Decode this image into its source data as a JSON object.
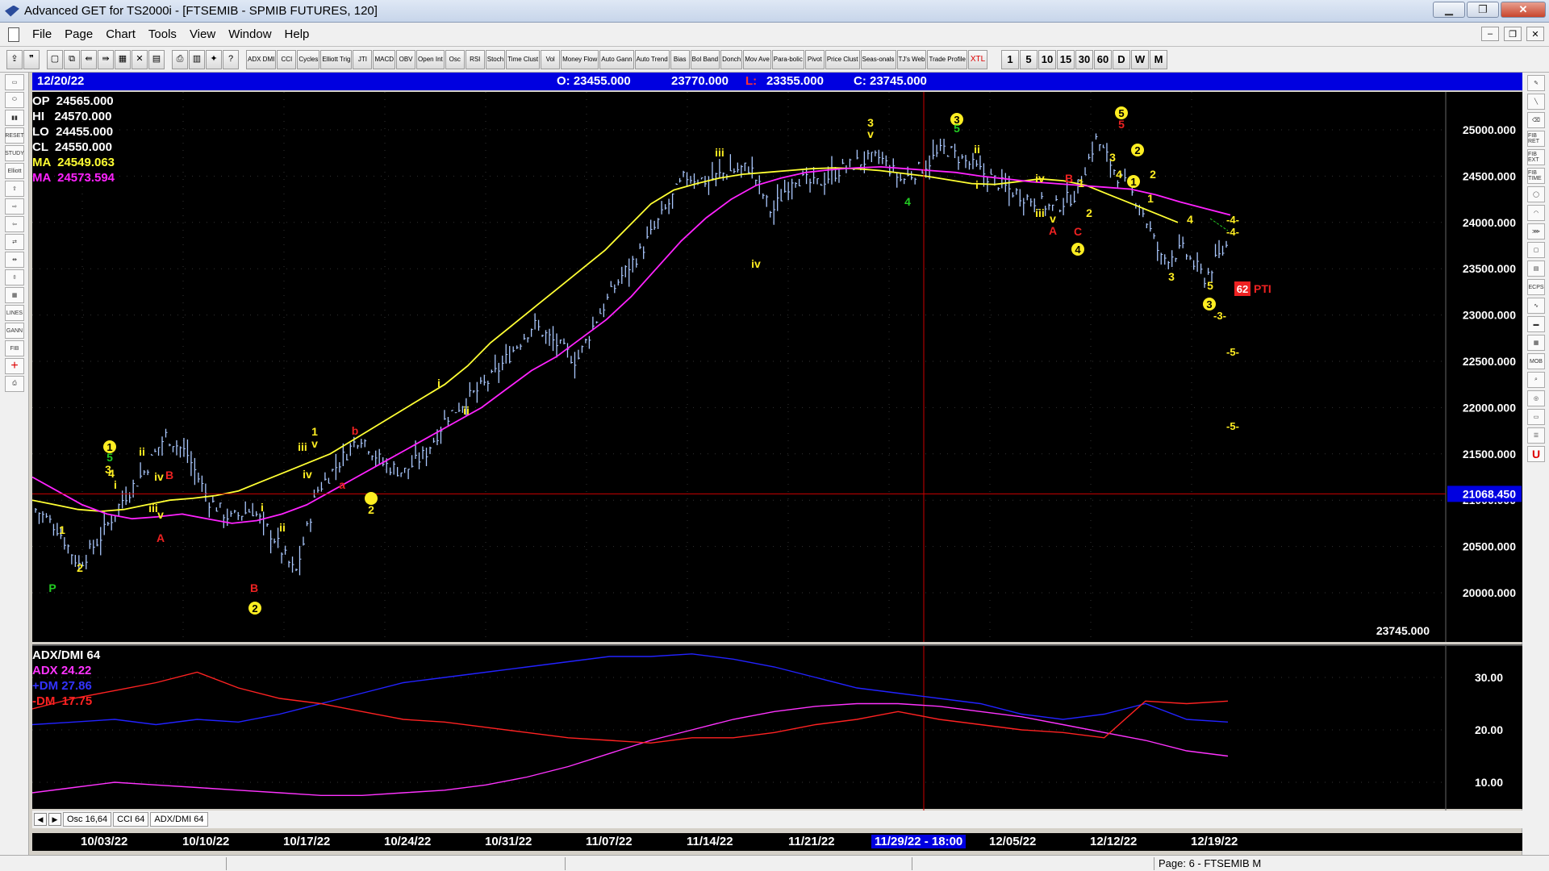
{
  "window": {
    "title": "Advanced GET for TS2000i - [FTSEMIB - SPMIB FUTURES, 120]",
    "ghost_title": "Advanced GET for TS2000i - [FTSEMIB - SPMIB FUTURES, 120]"
  },
  "menu": [
    "File",
    "Page",
    "Chart",
    "Tools",
    "View",
    "Window",
    "Help"
  ],
  "toolbar": {
    "study_buttons": [
      "ADX DMI",
      "CCI",
      "Cycles",
      "Elliott Trig",
      "JTI",
      "MACD",
      "OBV",
      "Open Int",
      "Osc",
      "RSI",
      "Stoch",
      "Time Clust",
      "Vol",
      "Money Flow",
      "Auto Gann",
      "Auto Trend",
      "Bias",
      "Bol Band",
      "Donch",
      "Mov Ave",
      "Para-bolic",
      "Pivot",
      "Price Clust",
      "Seas-onals",
      "TJ's Web",
      "Trade Profile",
      "XTL"
    ],
    "period_buttons": [
      "1",
      "5",
      "10",
      "15",
      "30",
      "60",
      "D",
      "W",
      "M"
    ]
  },
  "infobar": {
    "date": "12/20/22",
    "open": "O: 23455.000",
    "high": "23770.000",
    "low_label": "L:",
    "low": "23355.000",
    "close": "C: 23745.000"
  },
  "legend": {
    "op": "OP  24565.000",
    "hi": "HI   24570.000",
    "lo": "LO  24455.000",
    "cl": "CL  24550.000",
    "ma_yellow": "MA  24549.063",
    "ma_magenta": "MA  24573.594"
  },
  "colors": {
    "yellow_ma": "#ffff33",
    "magenta_ma": "#ff22ff",
    "price_bars": "#aac8ff",
    "adx": "#ff33ff",
    "plus_dm": "#2222ff",
    "minus_dm": "#ff2222",
    "info_bar": "#0000e0",
    "crosshair": "#cc0000"
  },
  "price_axis": {
    "labels": [
      "25000.000",
      "24500.000",
      "24000.000",
      "23500.000",
      "23000.000",
      "22500.000",
      "22000.000",
      "21500.000",
      "21000.000",
      "20500.000",
      "20000.000"
    ],
    "crosshair_value": "21068.450",
    "last_value": "23745.000"
  },
  "osc": {
    "title": "ADX/DMI 64",
    "adx": "ADX 24.22",
    "plus_dm": "+DM 27.86",
    "minus_dm": "-DM  17.75",
    "axis_labels": [
      "30.00",
      "20.00",
      "10.00"
    ]
  },
  "tabs": [
    "Osc 16,64",
    "CCI 64",
    "ADX/DMI 64"
  ],
  "dates": [
    "10/03/22",
    "10/10/22",
    "10/17/22",
    "10/24/22",
    "10/31/22",
    "11/07/22",
    "11/14/22",
    "11/21/22",
    "11/29/22 - 18:00",
    "12/05/22",
    "12/12/22",
    "12/19/22"
  ],
  "status": "Page: 6 - FTSEMIB M",
  "wave_labels": {
    "pti": "PTI",
    "pti_value": "62",
    "targets": [
      "-4-",
      "-4-",
      "-3-",
      "-5-",
      "-5-"
    ]
  },
  "chart_data": {
    "type": "line",
    "series": [
      {
        "name": "",
        "values": [
          20900,
          20700,
          20300,
          20600,
          21000,
          21300,
          21700,
          21500,
          21000,
          20800,
          20900,
          20600,
          20200,
          21100,
          21400,
          21700,
          21400,
          21300,
          21500,
          21900,
          22100,
          22300,
          22600,
          22900,
          22700,
          22500,
          23000,
          23400,
          23700,
          24100,
          24500,
          24450,
          24550,
          24600,
          24100,
          24500,
          24400,
          24550,
          24650,
          24700,
          24450,
          24600,
          24800,
          24650,
          24500,
          24350,
          24250,
          24150,
          24300,
          24900,
          24500,
          24200,
          23600,
          23700,
          23400,
          23745
        ]
      },
      {
        "name": "",
        "values": [
          21000,
          20950,
          20900,
          20880,
          20900,
          20950,
          21000,
          21020,
          21050,
          21100,
          21200,
          21300,
          21400,
          21500,
          21650,
          21800,
          21950,
          22100,
          22250,
          22450,
          22700,
          22900,
          23100,
          23300,
          23500,
          23700,
          23950,
          24200,
          24350,
          24420,
          24480,
          24520,
          24540,
          24560,
          24580,
          24590,
          24580,
          24560,
          24530,
          24500,
          24460,
          24420,
          24410,
          24440,
          24470,
          24450,
          24400,
          24300,
          24200,
          24100,
          24000
        ]
      },
      {
        "name": "",
        "values": [
          21250,
          21100,
          20950,
          20850,
          20800,
          20820,
          20850,
          20800,
          20750,
          20780,
          20850,
          20950,
          21100,
          21250,
          21400,
          21550,
          21700,
          21850,
          22000,
          22200,
          22400,
          22550,
          22750,
          22950,
          23200,
          23500,
          23800,
          24050,
          24250,
          24400,
          24480,
          24540,
          24570,
          24590,
          24600,
          24580,
          24560,
          24540,
          24500,
          24470,
          24440,
          24420,
          24400,
          24380,
          24360,
          24300,
          24220,
          24150,
          24080
        ]
      }
    ],
    "x_range": [
      "10/03/22",
      "12/20/22"
    ],
    "y_range": [
      19500,
      25300
    ],
    "osc_series": {
      "adx": [
        8,
        9,
        10,
        9.5,
        9,
        8.5,
        8,
        7.5,
        7.5,
        8,
        8.5,
        9.5,
        11,
        13,
        15.5,
        18,
        20,
        22,
        23.5,
        24.5,
        25,
        25,
        24.5,
        23.5,
        22.5,
        21,
        19.5,
        18,
        16,
        15
      ],
      "plus_dm": [
        21,
        21.5,
        22,
        21,
        22,
        21.5,
        23,
        25,
        27,
        29,
        30,
        31,
        32,
        33,
        34,
        34,
        34.5,
        33.5,
        32,
        30,
        28,
        27,
        26,
        25,
        23,
        22,
        23,
        25,
        22,
        21.5
      ],
      "minus_dm": [
        24,
        26,
        27.5,
        29,
        31,
        28,
        26,
        25,
        23.5,
        22,
        21.5,
        20.5,
        19.5,
        18.5,
        18,
        17.5,
        18.5,
        18.5,
        19.5,
        21,
        22,
        23.5,
        22,
        21,
        20,
        19.5,
        18.5,
        25.5,
        25,
        25.5
      ]
    }
  }
}
